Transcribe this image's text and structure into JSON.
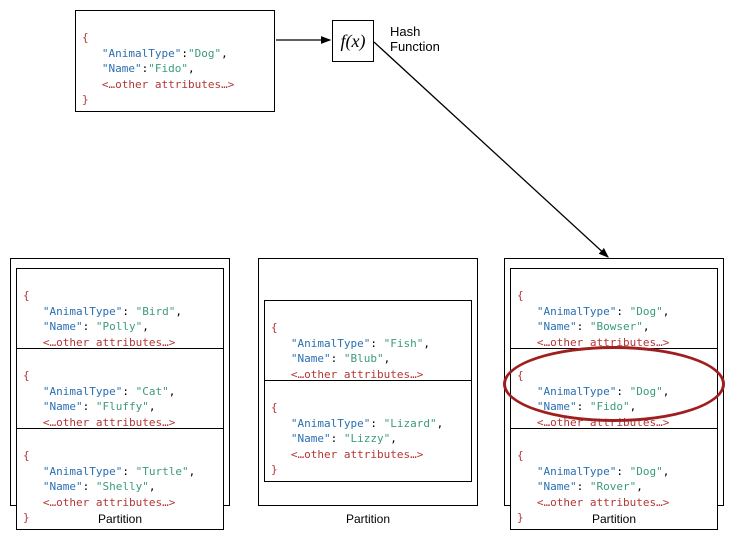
{
  "input_doc": {
    "animalType": "Dog",
    "name": "Fido",
    "other": "<…other attributes…>"
  },
  "hash": {
    "fx": "f(x)",
    "label1": "Hash",
    "label2": "Function"
  },
  "partitions": [
    {
      "label": "Partition",
      "docs": [
        {
          "animalType": "Bird",
          "name": "Polly",
          "other": "<…other attributes…>"
        },
        {
          "animalType": "Cat",
          "name": "Fluffy",
          "other": "<…other attributes…>"
        },
        {
          "animalType": "Turtle",
          "name": "Shelly",
          "other": "<…other attributes…>"
        }
      ]
    },
    {
      "label": "Partition",
      "docs": [
        {
          "animalType": "Fish",
          "name": "Blub",
          "other": "<…other attributes…>"
        },
        {
          "animalType": "Lizard",
          "name": "Lizzy",
          "other": "<…other attributes…>"
        }
      ]
    },
    {
      "label": "Partition",
      "docs": [
        {
          "animalType": "Dog",
          "name": "Bowser",
          "other": "<…other attributes…>"
        },
        {
          "animalType": "Dog",
          "name": "Fido",
          "other": "<…other attributes…>",
          "highlight": true
        },
        {
          "animalType": "Dog",
          "name": "Rover",
          "other": "<…other attributes…>"
        }
      ]
    }
  ],
  "key_animal": "\"AnimalType\"",
  "key_name": "\"Name\"",
  "chart_data": {
    "type": "table",
    "description": "Hash-partitioning diagram: an input JSON document is fed to a hash function f(x) which routes it to one of three partitions based on (presumably) the AnimalType key.",
    "input": {
      "AnimalType": "Dog",
      "Name": "Fido"
    },
    "function": "f(x)",
    "partitions": [
      {
        "index": 0,
        "items": [
          {
            "AnimalType": "Bird",
            "Name": "Polly"
          },
          {
            "AnimalType": "Cat",
            "Name": "Fluffy"
          },
          {
            "AnimalType": "Turtle",
            "Name": "Shelly"
          }
        ]
      },
      {
        "index": 1,
        "items": [
          {
            "AnimalType": "Fish",
            "Name": "Blub"
          },
          {
            "AnimalType": "Lizard",
            "Name": "Lizzy"
          }
        ]
      },
      {
        "index": 2,
        "items": [
          {
            "AnimalType": "Dog",
            "Name": "Bowser"
          },
          {
            "AnimalType": "Dog",
            "Name": "Fido",
            "routed_here": true
          },
          {
            "AnimalType": "Dog",
            "Name": "Rover"
          }
        ]
      }
    ]
  }
}
